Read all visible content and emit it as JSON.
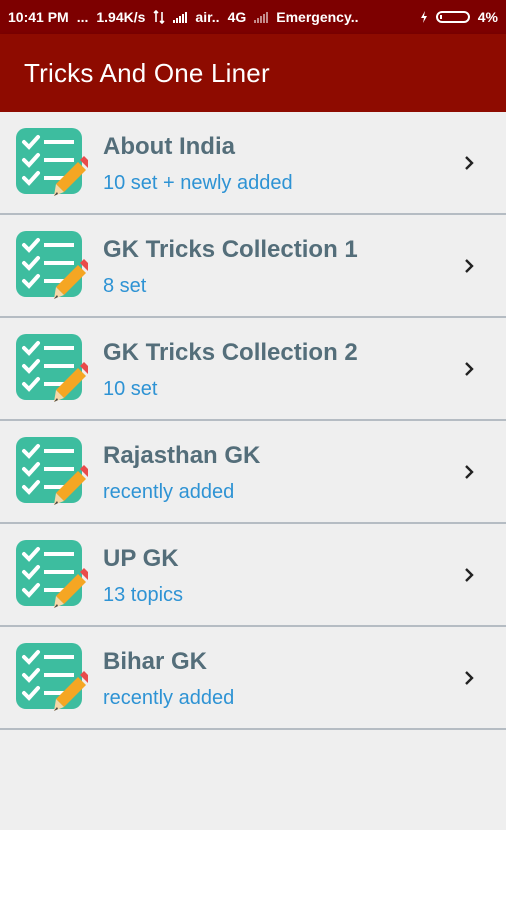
{
  "status_bar": {
    "time": "10:41 PM",
    "dots": "...",
    "speed": "1.94K/s",
    "carrier1": "air..",
    "network": "4G",
    "carrier2": "Emergency..",
    "battery": "4%"
  },
  "app_bar": {
    "title": "Tricks And One Liner"
  },
  "items": [
    {
      "title": "About India",
      "subtitle": "10 set + newly added"
    },
    {
      "title": "GK Tricks Collection 1",
      "subtitle": "8 set"
    },
    {
      "title": "GK Tricks Collection 2",
      "subtitle": "10 set"
    },
    {
      "title": "Rajasthan GK",
      "subtitle": "recently added"
    },
    {
      "title": "UP GK",
      "subtitle": "13 topics"
    },
    {
      "title": "Bihar GK",
      "subtitle": "recently added"
    }
  ],
  "colors": {
    "status_bar": "#7d0000",
    "app_bar": "#8e0b00",
    "list_bg": "#efefef",
    "title_text": "#546e7a",
    "subtitle_text": "#2e93d4",
    "icon_green": "#3dbd9f"
  },
  "icons": {
    "item": "checklist-pencil-icon",
    "chevron": "chevron-right-icon"
  }
}
